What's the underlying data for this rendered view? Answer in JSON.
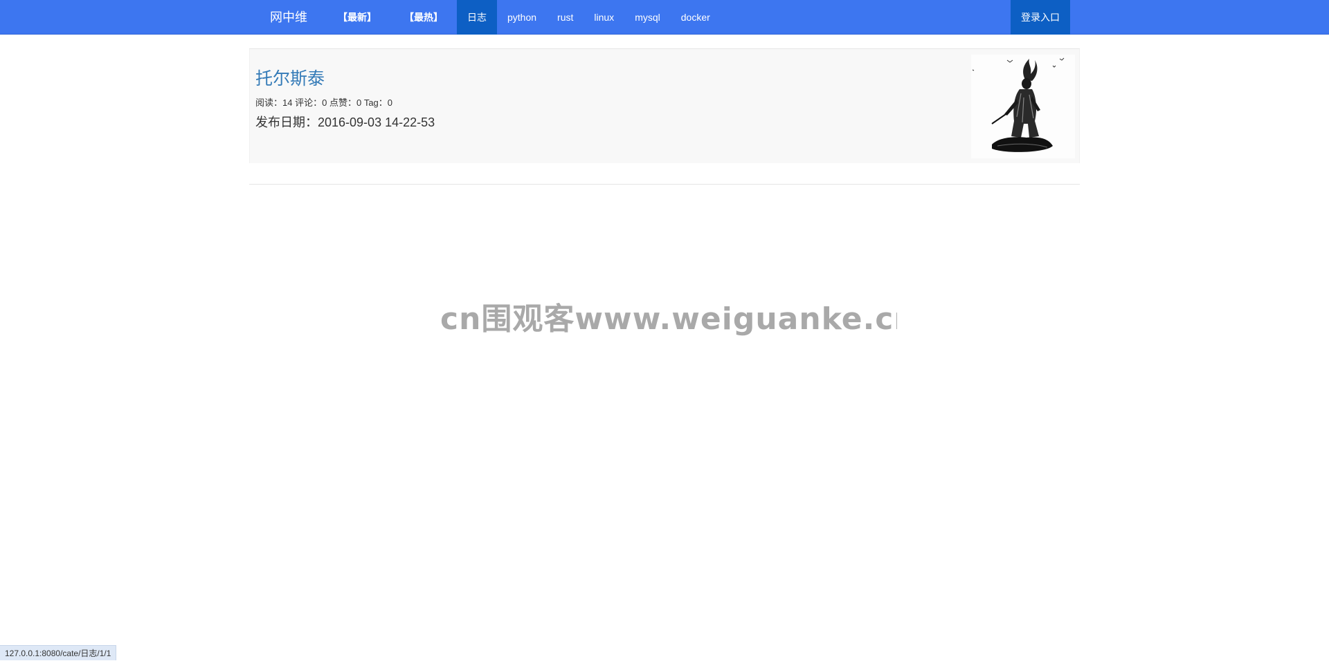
{
  "navbar": {
    "brand": "网中维",
    "items": [
      {
        "label": "【最新】",
        "active": false
      },
      {
        "label": "【最热】",
        "active": false
      },
      {
        "label": "日志",
        "active": true
      },
      {
        "label": "python",
        "active": false
      },
      {
        "label": "rust",
        "active": false
      },
      {
        "label": "linux",
        "active": false
      },
      {
        "label": "mysql",
        "active": false
      },
      {
        "label": "docker",
        "active": false
      }
    ],
    "login": "登录入口"
  },
  "post": {
    "title": "托尔斯泰",
    "meta": {
      "read_label": "阅读：",
      "read_count": "14",
      "comment_label": " 评论：",
      "comment_count": "0",
      "like_label": " 点赞：",
      "like_count": "0",
      "tag_label": " Tag：",
      "tag_count": "0"
    },
    "date_label": "发布日期：",
    "date": "2016-09-03 14-22-53",
    "thumbnail_icon": "samurai-illustration"
  },
  "watermark": "cn围观客www.weiguanke.cn",
  "statusbar": {
    "url": "127.0.0.1:8080/cate/日志/1/1"
  },
  "colors": {
    "navbar": "#3d76f0",
    "nav_active": "#0d5fc4",
    "title_link": "#337ab7",
    "card_bg": "#f8f8f8"
  }
}
